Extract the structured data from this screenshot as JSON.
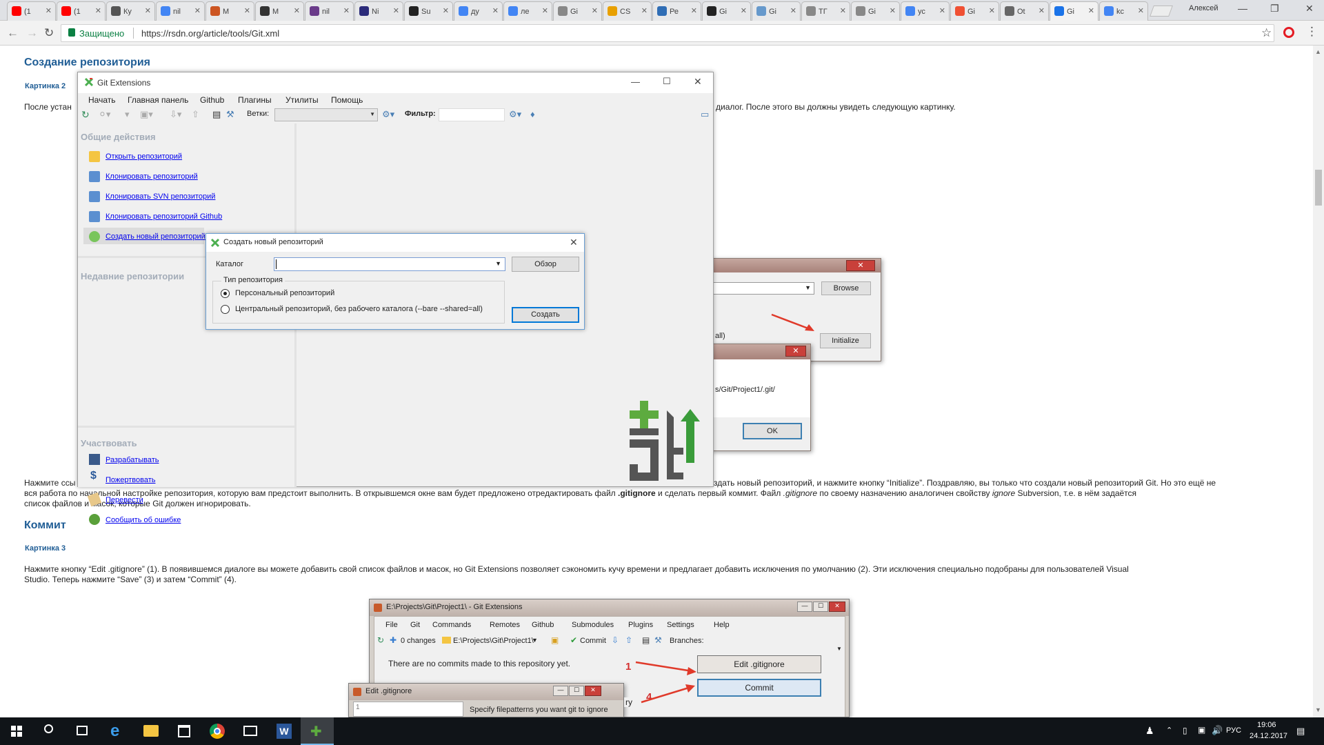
{
  "browser": {
    "tabs": [
      {
        "label": "(1",
        "icon": "youtube-icon",
        "color": "#ff0000"
      },
      {
        "label": "(1",
        "icon": "youtube-icon",
        "color": "#ff0000"
      },
      {
        "label": "Ку",
        "icon": "site-icon",
        "color": "#555555"
      },
      {
        "label": "nil",
        "icon": "google-icon",
        "color": "#4285f4"
      },
      {
        "label": "М",
        "icon": "globe-icon",
        "color": "#cc5522"
      },
      {
        "label": "М",
        "icon": "check-icon",
        "color": "#333333"
      },
      {
        "label": "nil",
        "icon": "site-icon",
        "color": "#6a3b8a"
      },
      {
        "label": "Ni",
        "icon": "site-icon",
        "color": "#2b2b7a"
      },
      {
        "label": "Su",
        "icon": "hb-icon",
        "color": "#222222"
      },
      {
        "label": "ду",
        "icon": "google-icon",
        "color": "#4285f4"
      },
      {
        "label": "ле",
        "icon": "google-icon",
        "color": "#4285f4"
      },
      {
        "label": "Gi",
        "icon": "page-icon",
        "color": "#888888"
      },
      {
        "label": "CS",
        "icon": "site-icon",
        "color": "#e8a000"
      },
      {
        "label": "Ре",
        "icon": "site-icon",
        "color": "#2f6db5"
      },
      {
        "label": "Gi",
        "icon": "github-icon",
        "color": "#222222"
      },
      {
        "label": "Gi",
        "icon": "site-icon",
        "color": "#6699cc"
      },
      {
        "label": "ТГ",
        "icon": "page-icon",
        "color": "#888888"
      },
      {
        "label": "Gi",
        "icon": "page-icon",
        "color": "#888888"
      },
      {
        "label": "ус",
        "icon": "google-icon",
        "color": "#4285f4"
      },
      {
        "label": "Gi",
        "icon": "git-icon",
        "color": "#f05033"
      },
      {
        "label": "Ot",
        "icon": "site-icon",
        "color": "#666666"
      },
      {
        "label": "Gi",
        "icon": "site-icon",
        "color": "#1a73e8",
        "active": true
      },
      {
        "label": "kc",
        "icon": "google-icon",
        "color": "#4285f4"
      }
    ],
    "profile_name": "Алексей",
    "security_label": "Защищено",
    "url": "https://rsdn.org/article/tools/Git.xml"
  },
  "article": {
    "heading_repo": "Создание репозитория",
    "caption_2": "Картинка 2",
    "para_1_left": "После устан",
    "para_1_right": "диалог. После этого вы должны увидеть следующую картинку.",
    "para_2_left_line1": "Нажмите ссы",
    "para_2_right_line1": "здать новый репозиторий, и нажмите кнопку “Initialize”. Поздравляю, вы только что создали новый репозиторий Git. Но это ещё не",
    "para_2_line2_left": "вся работа по начальной настройке репозитория, которую вам предстоит выполнить. В открывшемся окне вам будет предложено отредактировать файл",
    "para_2_line2_bold": ".gitignore",
    "para_2_line2_mid": "и сделать первый коммит. Файл",
    "para_2_line2_italic": ".gitignore",
    "para_2_line2_mid2": "по своему назначению аналогичен свойству",
    "para_2_line2_italic2": "ignore",
    "para_2_line2_end": "Subversion, т.е. в нём задаётся",
    "para_2_line3": "список файлов и масок, которые Git должен игнорировать.",
    "heading_commit": "Коммит",
    "caption_3": "Картинка 3",
    "para_3_line1": "Нажмите кнопку “Edit .gitignore” (1). В появившемся диалоге вы можете добавить свой список файлов и масок, но Git Extensions позволяет сэкономить кучу времени и предлагает добавить исключения по умолчанию (2). Эти исключения специально подобраны для пользователей Visual",
    "para_3_line2": "Studio. Теперь нажмите “Save” (3) и затем “Commit” (4)."
  },
  "gitext": {
    "title": "Git Extensions",
    "menu": [
      "Начать",
      "Главная панель",
      "Github",
      "Плагины",
      "Утилиты",
      "Помощь"
    ],
    "toolbar": {
      "branches_label": "Ветки:",
      "filter_label": "Фильтр:"
    },
    "common_actions_title": "Общие действия",
    "common_actions": [
      {
        "label": "Открыть репозиторий",
        "icon": "folder-open-icon"
      },
      {
        "label": "Клонировать репозиторий",
        "icon": "clone-icon"
      },
      {
        "label": "Клонировать SVN репозиторий",
        "icon": "clone-svn-icon"
      },
      {
        "label": "Клонировать репозиторий Github",
        "icon": "clone-github-icon"
      },
      {
        "label": "Создать новый репозиторий",
        "icon": "create-repo-icon"
      }
    ],
    "recent_title": "Недавние репозитории",
    "participate_title": "Участвовать",
    "participate": [
      {
        "label": "Разрабатывать",
        "icon": "develop-icon"
      },
      {
        "label": "Пожертвовать",
        "icon": "dollar-icon"
      },
      {
        "label": "Перевести",
        "icon": "translate-icon"
      },
      {
        "label": "Сообщить об ошибке",
        "icon": "bug-icon"
      }
    ],
    "logo_colors": {
      "git": "#5dab3f",
      "ext": "#3a9c3a",
      "text": "#555555"
    }
  },
  "create_dialog": {
    "title": "Создать новый репозиторий",
    "catalog_label": "Каталог",
    "catalog_value": "",
    "browse_button": "Обзор",
    "type_group": "Тип репозитория",
    "option_personal": "Персональный репозиторий",
    "option_central": "Центральный репозиторий, без рабочего каталога  (--bare --shared=all)",
    "selected_option": "personal",
    "create_button": "Создать"
  },
  "shot_init": {
    "browse_button": "Browse",
    "partial_text": "all)",
    "initialize_button": "Initialize",
    "msg_path": "s/Git/Project1/.git/",
    "ok_button": "OK"
  },
  "shot_commit": {
    "title": "E:\\Projects\\Git\\Project1\\ - Git Extensions",
    "menu": [
      "File",
      "Git",
      "Commands",
      "Remotes",
      "Github",
      "Submodules",
      "Plugins",
      "Settings",
      "Help"
    ],
    "changes_label": "0 changes",
    "path_label": "E:\\Projects\\Git\\Project1\\",
    "commit_label": "Commit",
    "branches_label": "Branches:",
    "no_commits": "There are no commits made to this repository yet.",
    "edit_gitignore_button": "Edit .gitignore",
    "commit_button": "Commit",
    "marker_1": "1",
    "marker_4": "4",
    "gitignore_title": "Edit .gitignore",
    "gitignore_line": "1",
    "gitignore_hint": "Specify filepatterns you want git to ignore",
    "partial_ry": "ry"
  },
  "taskbar": {
    "lang": "РУС",
    "time": "19:06",
    "date": "24.12.2017"
  }
}
